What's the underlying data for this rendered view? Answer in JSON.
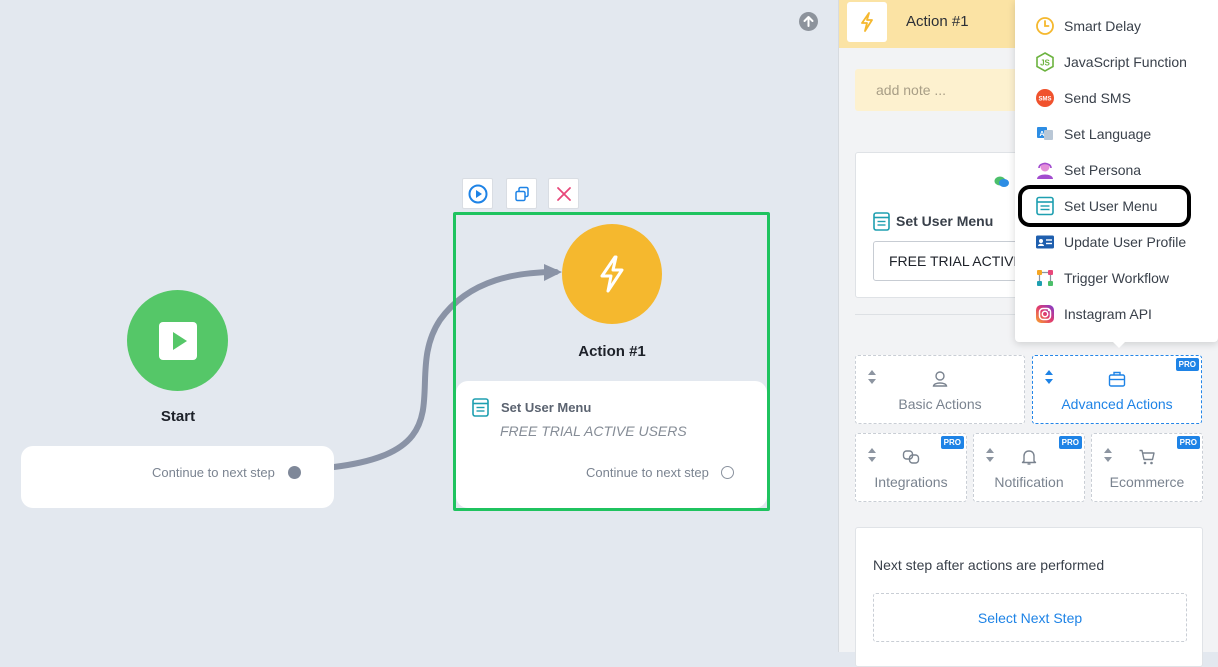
{
  "canvas": {
    "start_node": {
      "title": "Start",
      "continue_text": "Continue to next step"
    },
    "action_node": {
      "title": "Action #1",
      "step_label": "Set User Menu",
      "step_value": "FREE TRIAL ACTIVE USERS",
      "continue_text": "Continue to next step"
    }
  },
  "panel": {
    "header_title": "Action #1",
    "note_placeholder": "add note ...",
    "setting": {
      "label": "Set User Menu",
      "value": "FREE TRIAL ACTIVE USERS"
    },
    "categories": [
      {
        "label": "Basic Actions",
        "pro": false
      },
      {
        "label": "Advanced Actions",
        "pro": true,
        "badge": "PRO"
      },
      {
        "label": "Integrations",
        "pro": true,
        "badge": "PRO"
      },
      {
        "label": "Notification",
        "pro": true,
        "badge": "PRO"
      },
      {
        "label": "Ecommerce",
        "pro": true,
        "badge": "PRO"
      }
    ],
    "next_step": {
      "label": "Next step after actions are performed",
      "button": "Select Next Step"
    }
  },
  "dropdown": {
    "items": [
      {
        "label": "Smart Delay",
        "icon": "clock-icon"
      },
      {
        "label": "JavaScript Function",
        "icon": "js-icon"
      },
      {
        "label": "Send SMS",
        "icon": "sms-icon"
      },
      {
        "label": "Set Language",
        "icon": "language-icon"
      },
      {
        "label": "Set Persona",
        "icon": "persona-icon"
      },
      {
        "label": "Set User Menu",
        "icon": "user-menu-icon"
      },
      {
        "label": "Update User Profile",
        "icon": "profile-card-icon"
      },
      {
        "label": "Trigger Workflow",
        "icon": "workflow-icon"
      },
      {
        "label": "Instagram API",
        "icon": "instagram-icon"
      }
    ],
    "sms_badge": "SMS",
    "js_badge": "JS"
  },
  "colors": {
    "start_green": "#55c768",
    "action_yellow": "#f5b82e",
    "selected_frame": "#1fc35f",
    "accent_blue": "#1e83e6"
  }
}
